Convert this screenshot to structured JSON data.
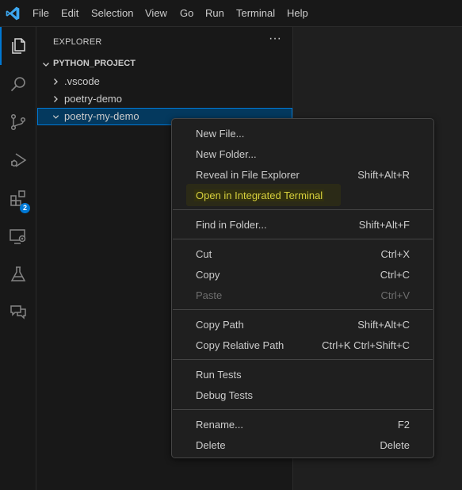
{
  "menubar": {
    "items": [
      "File",
      "Edit",
      "Selection",
      "View",
      "Go",
      "Run",
      "Terminal",
      "Help"
    ]
  },
  "activitybar": {
    "items": [
      {
        "icon": "explorer-icon",
        "active": true
      },
      {
        "icon": "search-icon"
      },
      {
        "icon": "source-control-icon"
      },
      {
        "icon": "run-debug-icon"
      },
      {
        "icon": "extensions-icon",
        "badge": "2"
      },
      {
        "icon": "remote-explorer-icon"
      },
      {
        "icon": "testing-icon"
      },
      {
        "icon": "chat-icon"
      }
    ]
  },
  "sidebar": {
    "title": "EXPLORER",
    "more": "···",
    "section_title": "PYTHON_PROJECT",
    "tree": [
      {
        "label": ".vscode",
        "expanded": false
      },
      {
        "label": "poetry-demo",
        "expanded": false
      },
      {
        "label": "poetry-my-demo",
        "expanded": true,
        "selected": true
      }
    ]
  },
  "context_menu": {
    "groups": [
      [
        {
          "label": "New File...",
          "key": ""
        },
        {
          "label": "New Folder...",
          "key": ""
        },
        {
          "label": "Reveal in File Explorer",
          "key": "Shift+Alt+R"
        },
        {
          "label": "Open in Integrated Terminal",
          "key": "",
          "highlighted": true
        }
      ],
      [
        {
          "label": "Find in Folder...",
          "key": "Shift+Alt+F"
        }
      ],
      [
        {
          "label": "Cut",
          "key": "Ctrl+X"
        },
        {
          "label": "Copy",
          "key": "Ctrl+C"
        },
        {
          "label": "Paste",
          "key": "Ctrl+V",
          "disabled": true
        }
      ],
      [
        {
          "label": "Copy Path",
          "key": "Shift+Alt+C"
        },
        {
          "label": "Copy Relative Path",
          "key": "Ctrl+K Ctrl+Shift+C"
        }
      ],
      [
        {
          "label": "Run Tests",
          "key": ""
        },
        {
          "label": "Debug Tests",
          "key": ""
        }
      ],
      [
        {
          "label": "Rename...",
          "key": "F2"
        },
        {
          "label": "Delete",
          "key": "Delete"
        }
      ]
    ]
  },
  "colors": {
    "accent": "#0078d4",
    "highlight_text": "#d7d03c",
    "background": "#1f1f1f"
  }
}
